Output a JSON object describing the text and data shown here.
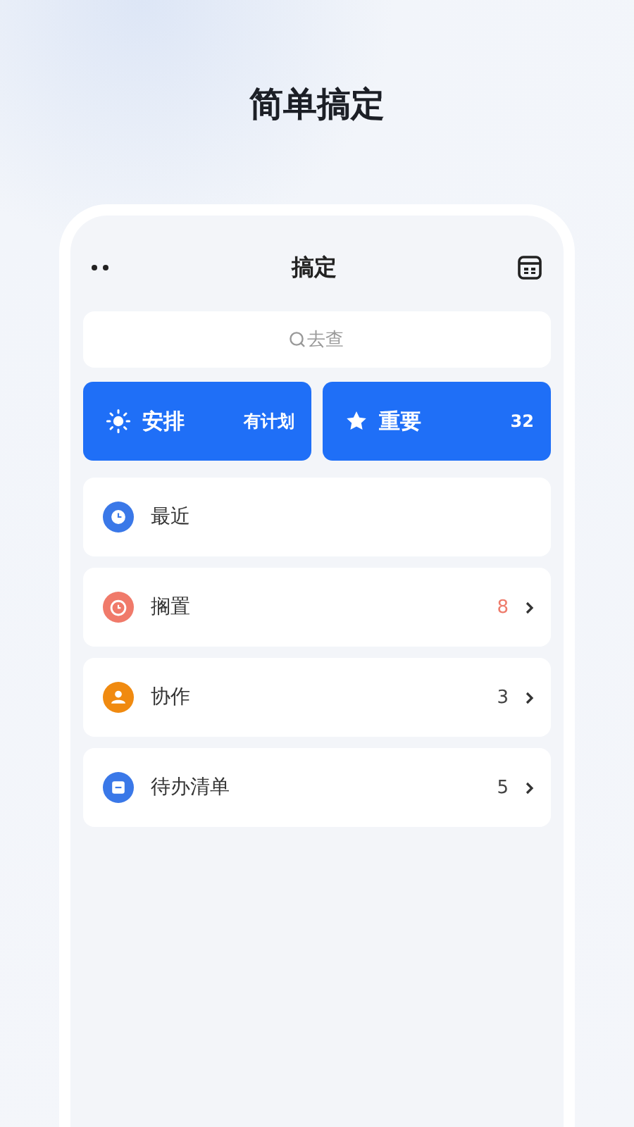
{
  "headline": "简单搞定",
  "app": {
    "title": "搞定",
    "search": {
      "placeholder": "去查"
    },
    "tiles": [
      {
        "kind": "sun",
        "label": "安排",
        "value": "有计划"
      },
      {
        "kind": "star",
        "label": "重要",
        "value": "32"
      }
    ],
    "lists": [
      {
        "kind": "clock",
        "color": "#3a78e8",
        "label": "最近"
      },
      {
        "kind": "alarm",
        "color": "#f07a6a",
        "label": "搁置",
        "count": "8",
        "alert": true
      },
      {
        "kind": "people",
        "color": "#f08a10",
        "label": "协作",
        "count": "3",
        "alert": false
      },
      {
        "kind": "list",
        "color": "#3a78e8",
        "label": "待办清单",
        "count": "5",
        "alert": false
      }
    ]
  }
}
